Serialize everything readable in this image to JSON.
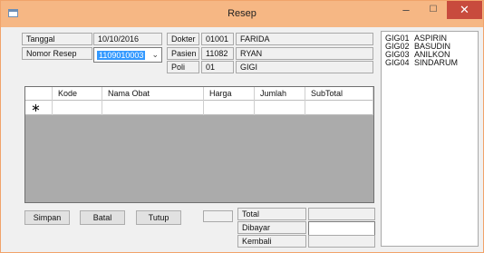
{
  "window": {
    "title": "Resep",
    "minimize_glyph": "‒",
    "maximize_glyph": "☐",
    "close_glyph": "✕"
  },
  "header": {
    "tanggal_label": "Tanggal",
    "tanggal_value": "10/10/2016",
    "nomor_resep_label": "Nomor Resep",
    "nomor_resep_value": "1109010003",
    "dokter_label": "Dokter",
    "dokter_code": "01001",
    "dokter_name": "FARIDA",
    "pasien_label": "Pasien",
    "pasien_code": "11082",
    "pasien_name": "RYAN",
    "poli_label": "Poli",
    "poli_code": "01",
    "poli_name": "GIGI"
  },
  "grid": {
    "columns": [
      "Kode",
      "Nama Obat",
      "Harga",
      "Jumlah",
      "SubTotal"
    ],
    "new_row_marker": "∗"
  },
  "buttons": {
    "simpan": "Simpan",
    "batal": "Batal",
    "tutup": "Tutup"
  },
  "totals": {
    "total_label": "Total",
    "dibayar_label": "Dibayar",
    "kembali_label": "Kembali"
  },
  "drug_list": [
    {
      "code": "GIG01",
      "name": "ASPIRIN"
    },
    {
      "code": "GIG02",
      "name": "BASUDIN"
    },
    {
      "code": "GIG03",
      "name": "ANILKON"
    },
    {
      "code": "GIG04",
      "name": "SINDARUM"
    }
  ],
  "colors": {
    "titlebar": "#f6b784",
    "close_button": "#c84b3d",
    "selection": "#3399ff",
    "grid_background": "#ababab"
  }
}
